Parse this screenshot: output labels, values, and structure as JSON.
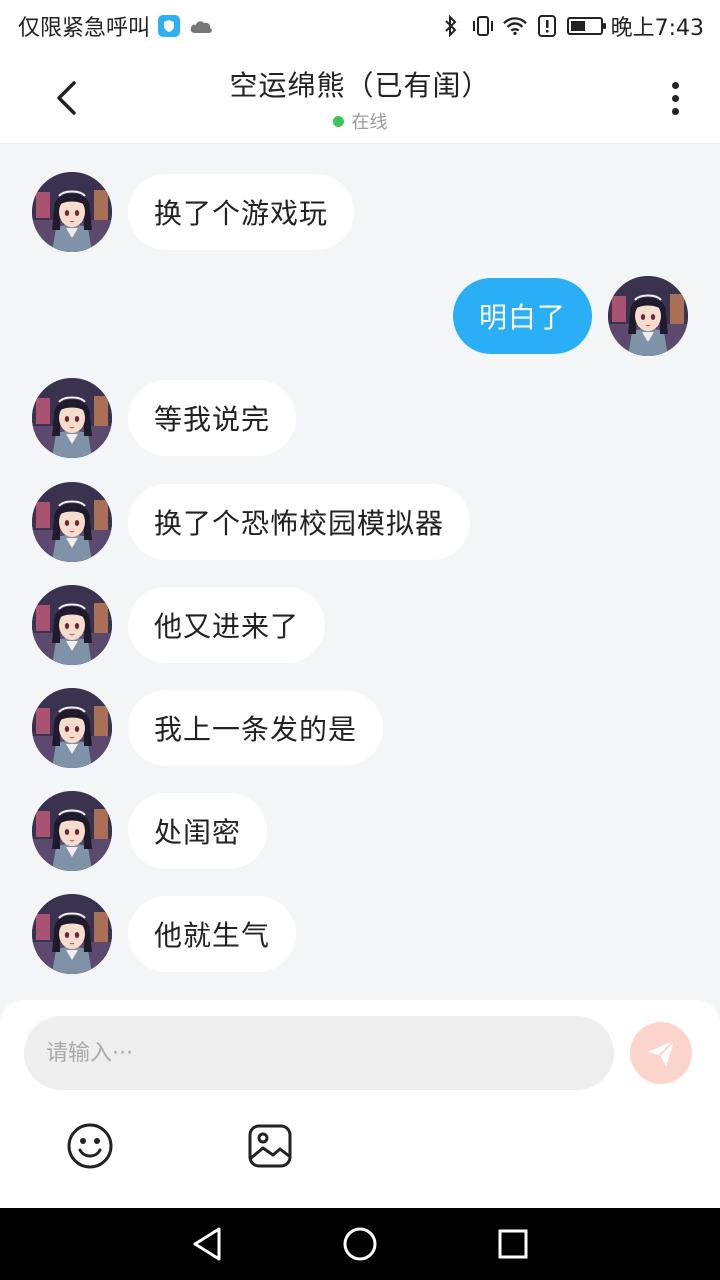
{
  "status_bar": {
    "left_text": "仅限紧急呼叫",
    "time": "晚上7:43",
    "icons": [
      "shield-icon",
      "cloud-icon",
      "bluetooth-icon",
      "vibrate-icon",
      "wifi-icon",
      "alert-icon",
      "battery-icon"
    ],
    "battery_level": 0.5
  },
  "header": {
    "title": "空运绵熊（已有闺）",
    "status": "在线",
    "online_color": "#3ac55a"
  },
  "messages": [
    {
      "side": "left",
      "text": "换了个游戏玩"
    },
    {
      "side": "right",
      "text": "明白了"
    },
    {
      "side": "left",
      "text": "等我说完"
    },
    {
      "side": "left",
      "text": "换了个恐怖校园模拟器"
    },
    {
      "side": "left",
      "text": "他又进来了"
    },
    {
      "side": "left",
      "text": "我上一条发的是"
    },
    {
      "side": "left",
      "text": "处闺密"
    },
    {
      "side": "left",
      "text": "他就生气"
    }
  ],
  "composer": {
    "placeholder": "请输入···",
    "value": ""
  },
  "colors": {
    "accent": "#2aaef5",
    "send_button": "#fbd5cc",
    "background": "#f4f5f7"
  }
}
